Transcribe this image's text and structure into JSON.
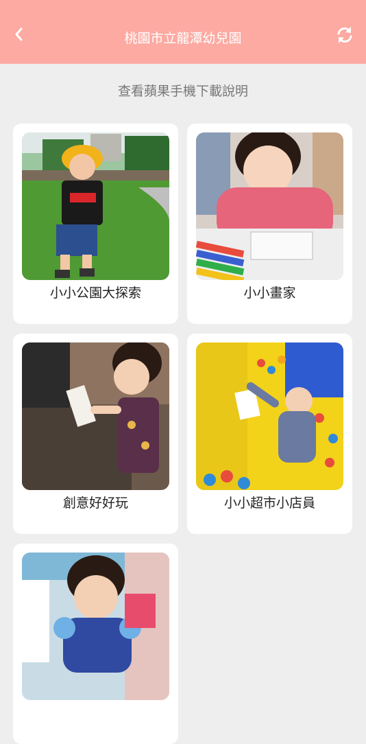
{
  "header": {
    "title": "桃園市立龍潭幼兒園",
    "back_icon": "chevron-left-icon",
    "refresh_icon": "refresh-icon",
    "bg_color": "#fcaaa2"
  },
  "notice": {
    "text": "查看蘋果手機下載說明"
  },
  "cards": [
    {
      "label": "小小公園大探索",
      "photo": "child-in-park-photo"
    },
    {
      "label": "小小畫家",
      "photo": "child-drawing-photo"
    },
    {
      "label": "創意好好玩",
      "photo": "child-crafting-photo"
    },
    {
      "label": "小小超市小店員",
      "photo": "baby-in-ball-pit-photo"
    },
    {
      "label": "",
      "photo": "child-playing-photo"
    }
  ]
}
